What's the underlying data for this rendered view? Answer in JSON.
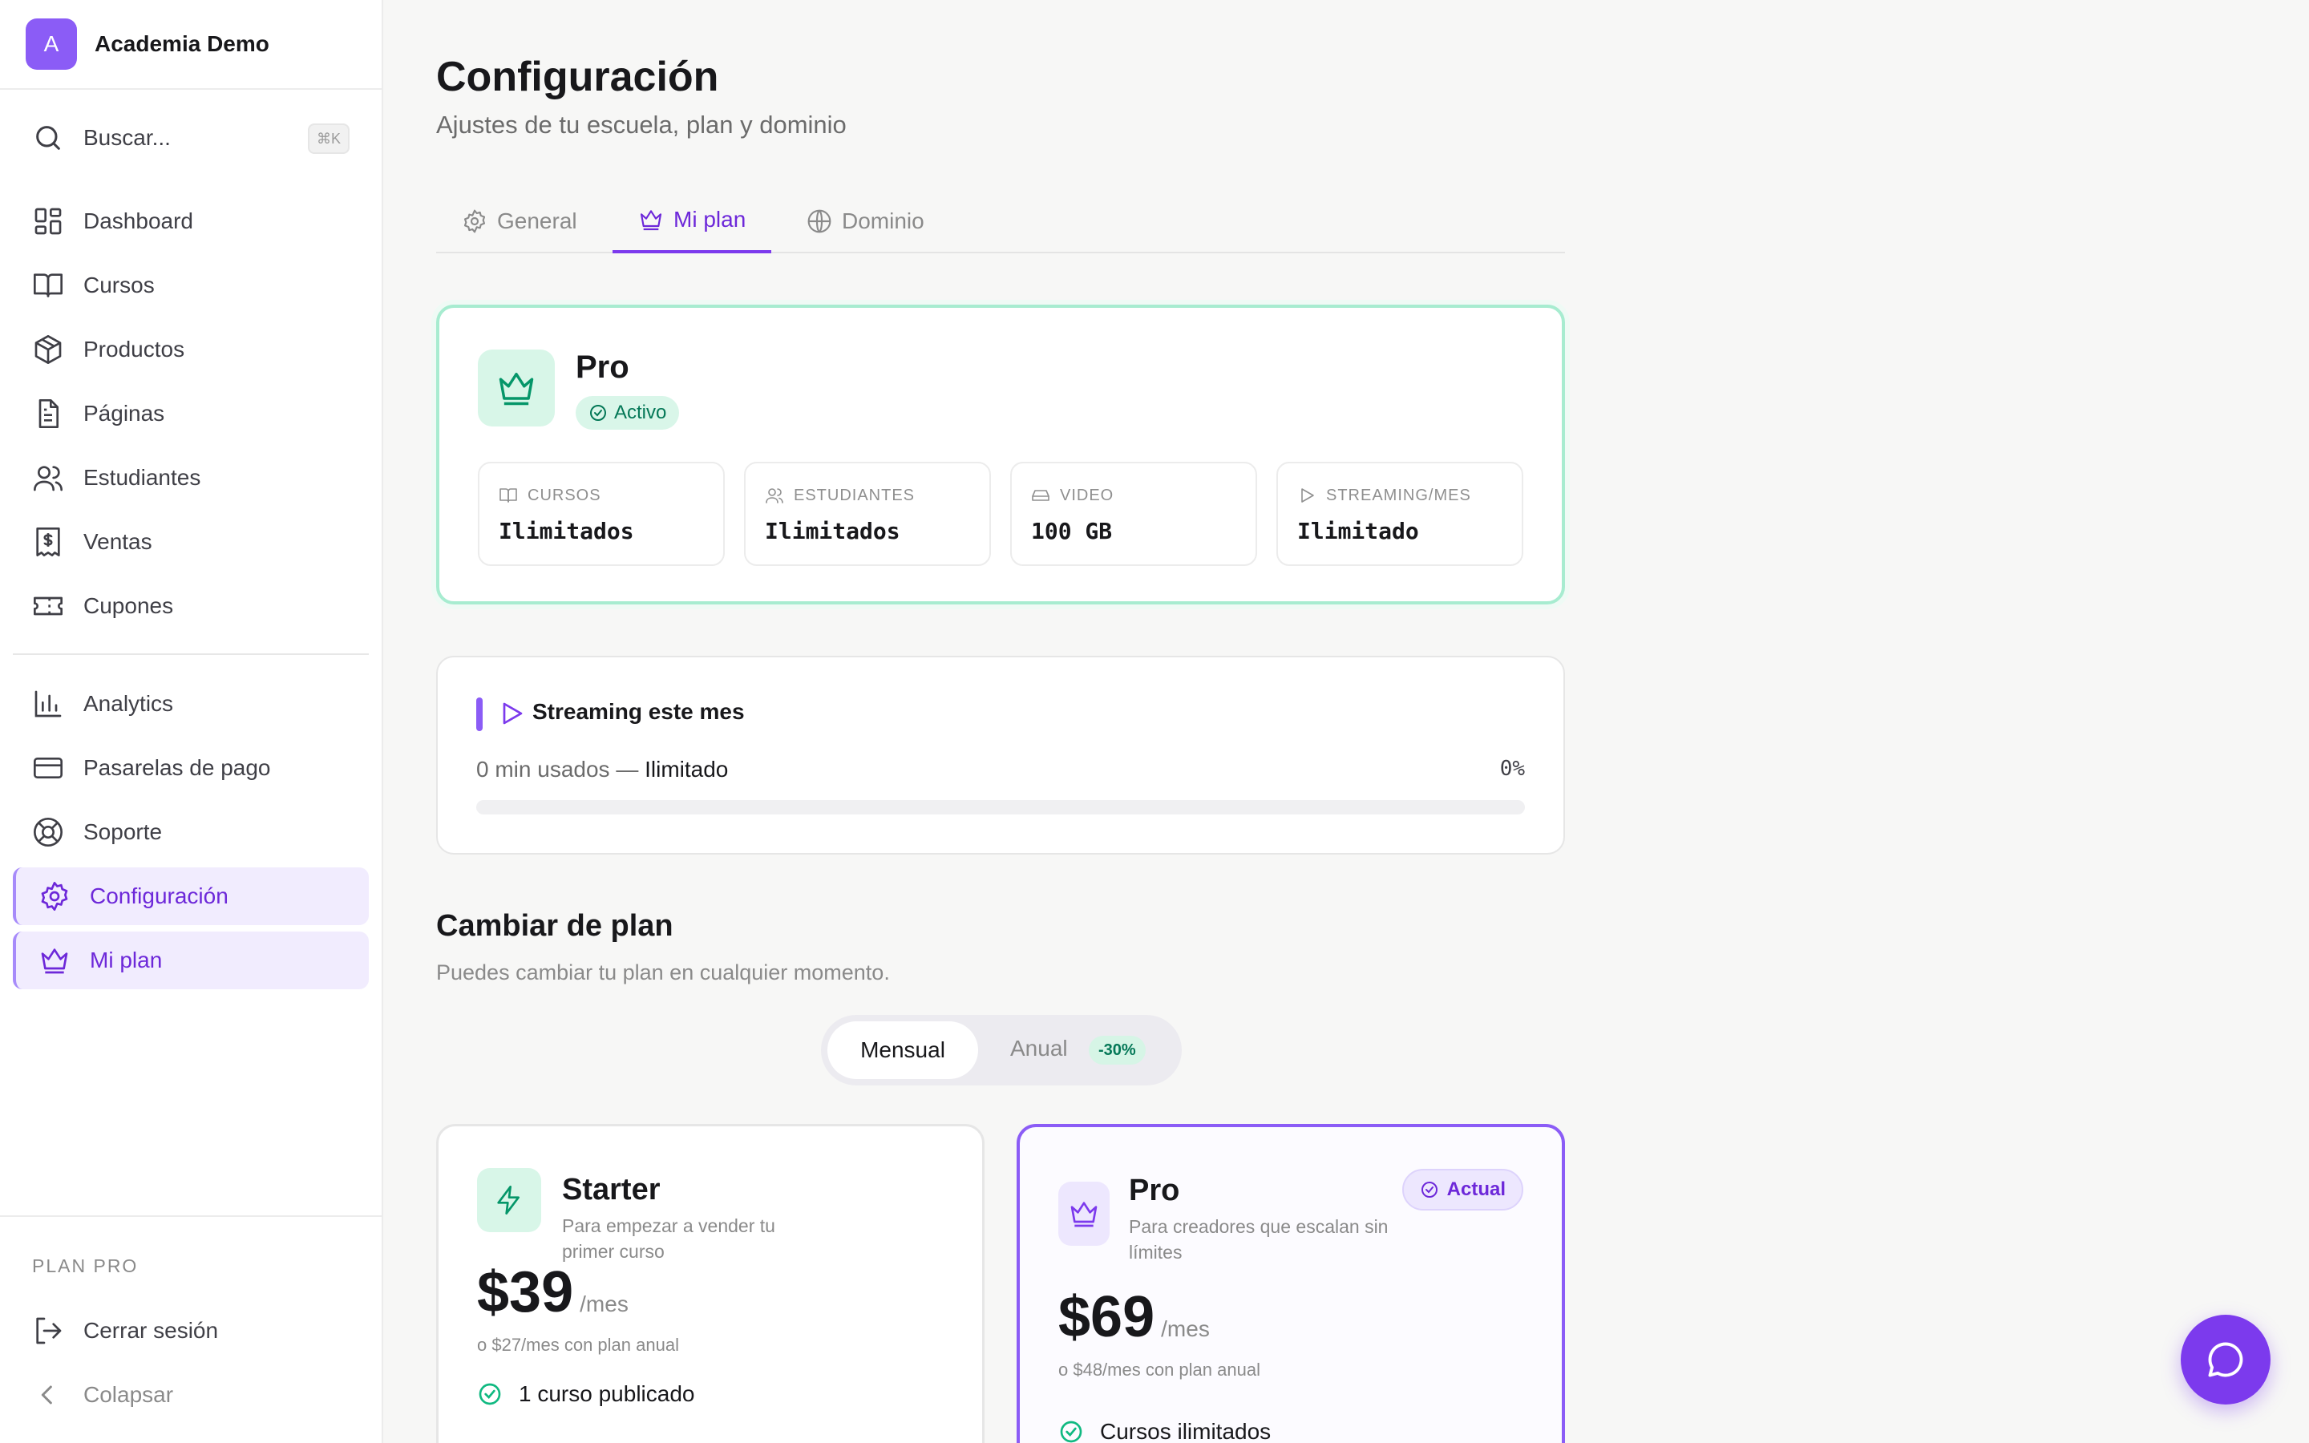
{
  "brand": {
    "initial": "A",
    "name": "Academia Demo"
  },
  "search": {
    "label": "Buscar...",
    "shortcut": "⌘K"
  },
  "sidebar": {
    "nav_primary": [
      {
        "label": "Dashboard",
        "icon": "dashboard-icon"
      },
      {
        "label": "Cursos",
        "icon": "book-icon"
      },
      {
        "label": "Productos",
        "icon": "package-icon"
      },
      {
        "label": "Páginas",
        "icon": "file-icon"
      },
      {
        "label": "Estudiantes",
        "icon": "users-icon"
      },
      {
        "label": "Ventas",
        "icon": "receipt-icon"
      },
      {
        "label": "Cupones",
        "icon": "ticket-icon"
      }
    ],
    "nav_secondary": [
      {
        "label": "Analytics",
        "icon": "bar-chart-icon"
      },
      {
        "label": "Pasarelas de pago",
        "icon": "credit-card-icon"
      },
      {
        "label": "Soporte",
        "icon": "lifebuoy-icon"
      },
      {
        "label": "Configuración",
        "icon": "gear-icon",
        "active": true
      },
      {
        "label": "Mi plan",
        "icon": "crown-icon",
        "active": true
      }
    ],
    "plan_caption": "PLAN PRO",
    "logout_label": "Cerrar sesión",
    "collapse_label": "Colapsar"
  },
  "page": {
    "title": "Configuración",
    "subtitle": "Ajustes de tu escuela, plan y dominio"
  },
  "tabs": [
    {
      "label": "General",
      "icon": "gear-icon"
    },
    {
      "label": "Mi plan",
      "icon": "crown-icon",
      "active": true
    },
    {
      "label": "Dominio",
      "icon": "globe-icon"
    }
  ],
  "current_plan": {
    "name": "Pro",
    "status": "Activo",
    "stats": [
      {
        "label": "CURSOS",
        "value": "Ilimitados",
        "icon": "book-icon"
      },
      {
        "label": "ESTUDIANTES",
        "value": "Ilimitados",
        "icon": "users-icon"
      },
      {
        "label": "VIDEO",
        "value": "100 GB",
        "icon": "drive-icon"
      },
      {
        "label": "STREAMING/MES",
        "value": "Ilimitado",
        "icon": "play-icon"
      }
    ]
  },
  "streaming": {
    "title": "Streaming este mes",
    "used": "0 min usados —",
    "limit": "Ilimitado",
    "percent_label": "0%",
    "progress": 0
  },
  "change_plan": {
    "title": "Cambiar de plan",
    "subtitle": "Puedes cambiar tu plan en cualquier momento.",
    "billing_monthly": "Mensual",
    "billing_annual": "Anual",
    "annual_discount": "-30%"
  },
  "plans": [
    {
      "name": "Starter",
      "description": "Para empezar a vender tu primer curso",
      "price": "$39",
      "period": "/mes",
      "annual_note": "o $27/mes con plan anual",
      "features": [
        "1 curso publicado"
      ],
      "icon": "lightning-icon"
    },
    {
      "name": "Pro",
      "description": "Para creadores que escalan sin límites",
      "price": "$69",
      "period": "/mes",
      "annual_note": "o $48/mes con plan anual",
      "features": [
        "Cursos ilimitados"
      ],
      "badge": "Actual",
      "icon": "crown-icon"
    }
  ],
  "colors": {
    "accent": "#7c3aed",
    "accent_soft": "#f1ecfe",
    "success": "#047857",
    "success_soft": "#d8f6e8"
  }
}
